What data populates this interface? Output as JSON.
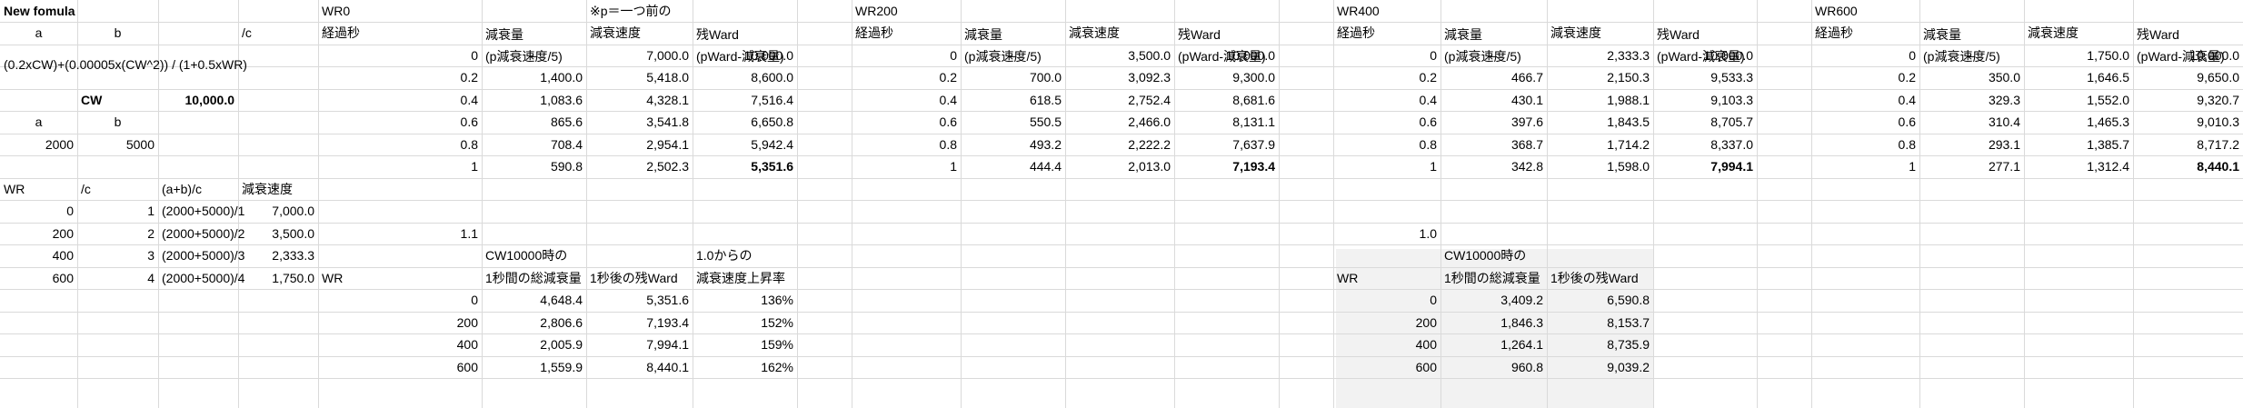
{
  "cells": [
    {
      "r": 0,
      "c": 0,
      "t": "New fomula",
      "b": true
    },
    {
      "r": 0,
      "c": 4,
      "t": "WR0"
    },
    {
      "r": 0,
      "c": 6,
      "t": "※p＝一つ前の"
    },
    {
      "r": 0,
      "c": 9,
      "t": "WR200"
    },
    {
      "r": 0,
      "c": 14,
      "t": "WR400"
    },
    {
      "r": 0,
      "c": 19,
      "t": "WR600"
    },
    {
      "r": 1,
      "c": 0,
      "t": "a",
      "a": "c"
    },
    {
      "r": 1,
      "c": 1,
      "t": "b",
      "a": "c"
    },
    {
      "r": 1,
      "c": 3,
      "t": "/c"
    },
    {
      "r": 1,
      "c": 4,
      "t": "経過秒"
    },
    {
      "r": 1,
      "c": 5,
      "t": "減衰量",
      "half": "top"
    },
    {
      "r": 1,
      "c": 5,
      "t": "(p減衰速度/5)",
      "half": "bot"
    },
    {
      "r": 1,
      "c": 6,
      "t": "減衰速度"
    },
    {
      "r": 1,
      "c": 7,
      "t": "残Ward",
      "half": "top"
    },
    {
      "r": 1,
      "c": 7,
      "t": "(pWard-減衰量)",
      "half": "bot"
    },
    {
      "r": 1,
      "c": 9,
      "t": "経過秒"
    },
    {
      "r": 1,
      "c": 10,
      "t": "減衰量",
      "half": "top"
    },
    {
      "r": 1,
      "c": 10,
      "t": "(p減衰速度/5)",
      "half": "bot"
    },
    {
      "r": 1,
      "c": 11,
      "t": "減衰速度"
    },
    {
      "r": 1,
      "c": 12,
      "t": "残Ward",
      "half": "top"
    },
    {
      "r": 1,
      "c": 12,
      "t": "(pWard-減衰量)",
      "half": "bot"
    },
    {
      "r": 1,
      "c": 14,
      "t": "経過秒"
    },
    {
      "r": 1,
      "c": 15,
      "t": "減衰量",
      "half": "top"
    },
    {
      "r": 1,
      "c": 15,
      "t": "(p減衰速度/5)",
      "half": "bot"
    },
    {
      "r": 1,
      "c": 16,
      "t": "減衰速度"
    },
    {
      "r": 1,
      "c": 17,
      "t": "残Ward",
      "half": "top"
    },
    {
      "r": 1,
      "c": 17,
      "t": "(pWard-減衰量)",
      "half": "bot"
    },
    {
      "r": 1,
      "c": 19,
      "t": "経過秒"
    },
    {
      "r": 1,
      "c": 20,
      "t": "減衰量",
      "half": "top"
    },
    {
      "r": 1,
      "c": 20,
      "t": "(p減衰速度/5)",
      "half": "bot"
    },
    {
      "r": 1,
      "c": 21,
      "t": "減衰速度"
    },
    {
      "r": 1,
      "c": 22,
      "t": "残Ward",
      "half": "top"
    },
    {
      "r": 1,
      "c": 22,
      "t": "(pWard-減衰量)",
      "half": "bot"
    },
    {
      "r": 2,
      "c": 0,
      "t": "(0.2xCW)+(0.00005x(CW^2)) / (1+0.5xWR)",
      "y": "low"
    },
    {
      "r": 2,
      "c": 4,
      "t": "0",
      "a": "r"
    },
    {
      "r": 2,
      "c": 5,
      "t": "–",
      "a": "c"
    },
    {
      "r": 2,
      "c": 6,
      "t": "7,000.0",
      "a": "r"
    },
    {
      "r": 2,
      "c": 7,
      "t": "10,000.0",
      "a": "r"
    },
    {
      "r": 2,
      "c": 9,
      "t": "0",
      "a": "r"
    },
    {
      "r": 2,
      "c": 10,
      "t": "–",
      "a": "c"
    },
    {
      "r": 2,
      "c": 11,
      "t": "3,500.0",
      "a": "r"
    },
    {
      "r": 2,
      "c": 12,
      "t": "10,000.0",
      "a": "r"
    },
    {
      "r": 2,
      "c": 14,
      "t": "0",
      "a": "r"
    },
    {
      "r": 2,
      "c": 15,
      "t": "–",
      "a": "c"
    },
    {
      "r": 2,
      "c": 16,
      "t": "2,333.3",
      "a": "r"
    },
    {
      "r": 2,
      "c": 17,
      "t": "10,000.0",
      "a": "r"
    },
    {
      "r": 2,
      "c": 19,
      "t": "0",
      "a": "r"
    },
    {
      "r": 2,
      "c": 20,
      "t": "–",
      "a": "c"
    },
    {
      "r": 2,
      "c": 21,
      "t": "1,750.0",
      "a": "r"
    },
    {
      "r": 2,
      "c": 22,
      "t": "10,000.0",
      "a": "r"
    },
    {
      "r": 3,
      "c": 4,
      "t": "0.2",
      "a": "r"
    },
    {
      "r": 3,
      "c": 5,
      "t": "1,400.0",
      "a": "r"
    },
    {
      "r": 3,
      "c": 6,
      "t": "5,418.0",
      "a": "r"
    },
    {
      "r": 3,
      "c": 7,
      "t": "8,600.0",
      "a": "r"
    },
    {
      "r": 3,
      "c": 9,
      "t": "0.2",
      "a": "r"
    },
    {
      "r": 3,
      "c": 10,
      "t": "700.0",
      "a": "r"
    },
    {
      "r": 3,
      "c": 11,
      "t": "3,092.3",
      "a": "r"
    },
    {
      "r": 3,
      "c": 12,
      "t": "9,300.0",
      "a": "r"
    },
    {
      "r": 3,
      "c": 14,
      "t": "0.2",
      "a": "r"
    },
    {
      "r": 3,
      "c": 15,
      "t": "466.7",
      "a": "r"
    },
    {
      "r": 3,
      "c": 16,
      "t": "2,150.3",
      "a": "r"
    },
    {
      "r": 3,
      "c": 17,
      "t": "9,533.3",
      "a": "r"
    },
    {
      "r": 3,
      "c": 19,
      "t": "0.2",
      "a": "r"
    },
    {
      "r": 3,
      "c": 20,
      "t": "350.0",
      "a": "r"
    },
    {
      "r": 3,
      "c": 21,
      "t": "1,646.5",
      "a": "r"
    },
    {
      "r": 3,
      "c": 22,
      "t": "9,650.0",
      "a": "r"
    },
    {
      "r": 4,
      "c": 1,
      "t": "CW",
      "b": true
    },
    {
      "r": 4,
      "c": 2,
      "t": "10,000.0",
      "b": true,
      "a": "r"
    },
    {
      "r": 4,
      "c": 4,
      "t": "0.4",
      "a": "r"
    },
    {
      "r": 4,
      "c": 5,
      "t": "1,083.6",
      "a": "r"
    },
    {
      "r": 4,
      "c": 6,
      "t": "4,328.1",
      "a": "r"
    },
    {
      "r": 4,
      "c": 7,
      "t": "7,516.4",
      "a": "r"
    },
    {
      "r": 4,
      "c": 9,
      "t": "0.4",
      "a": "r"
    },
    {
      "r": 4,
      "c": 10,
      "t": "618.5",
      "a": "r"
    },
    {
      "r": 4,
      "c": 11,
      "t": "2,752.4",
      "a": "r"
    },
    {
      "r": 4,
      "c": 12,
      "t": "8,681.6",
      "a": "r"
    },
    {
      "r": 4,
      "c": 14,
      "t": "0.4",
      "a": "r"
    },
    {
      "r": 4,
      "c": 15,
      "t": "430.1",
      "a": "r"
    },
    {
      "r": 4,
      "c": 16,
      "t": "1,988.1",
      "a": "r"
    },
    {
      "r": 4,
      "c": 17,
      "t": "9,103.3",
      "a": "r"
    },
    {
      "r": 4,
      "c": 19,
      "t": "0.4",
      "a": "r"
    },
    {
      "r": 4,
      "c": 20,
      "t": "329.3",
      "a": "r"
    },
    {
      "r": 4,
      "c": 21,
      "t": "1,552.0",
      "a": "r"
    },
    {
      "r": 4,
      "c": 22,
      "t": "9,320.7",
      "a": "r"
    },
    {
      "r": 5,
      "c": 0,
      "t": "a",
      "a": "c"
    },
    {
      "r": 5,
      "c": 1,
      "t": "b",
      "a": "c"
    },
    {
      "r": 5,
      "c": 4,
      "t": "0.6",
      "a": "r"
    },
    {
      "r": 5,
      "c": 5,
      "t": "865.6",
      "a": "r"
    },
    {
      "r": 5,
      "c": 6,
      "t": "3,541.8",
      "a": "r"
    },
    {
      "r": 5,
      "c": 7,
      "t": "6,650.8",
      "a": "r"
    },
    {
      "r": 5,
      "c": 9,
      "t": "0.6",
      "a": "r"
    },
    {
      "r": 5,
      "c": 10,
      "t": "550.5",
      "a": "r"
    },
    {
      "r": 5,
      "c": 11,
      "t": "2,466.0",
      "a": "r"
    },
    {
      "r": 5,
      "c": 12,
      "t": "8,131.1",
      "a": "r"
    },
    {
      "r": 5,
      "c": 14,
      "t": "0.6",
      "a": "r"
    },
    {
      "r": 5,
      "c": 15,
      "t": "397.6",
      "a": "r"
    },
    {
      "r": 5,
      "c": 16,
      "t": "1,843.5",
      "a": "r"
    },
    {
      "r": 5,
      "c": 17,
      "t": "8,705.7",
      "a": "r"
    },
    {
      "r": 5,
      "c": 19,
      "t": "0.6",
      "a": "r"
    },
    {
      "r": 5,
      "c": 20,
      "t": "310.4",
      "a": "r"
    },
    {
      "r": 5,
      "c": 21,
      "t": "1,465.3",
      "a": "r"
    },
    {
      "r": 5,
      "c": 22,
      "t": "9,010.3",
      "a": "r"
    },
    {
      "r": 6,
      "c": 0,
      "t": "2000",
      "a": "r"
    },
    {
      "r": 6,
      "c": 1,
      "t": "5000",
      "a": "r"
    },
    {
      "r": 6,
      "c": 4,
      "t": "0.8",
      "a": "r"
    },
    {
      "r": 6,
      "c": 5,
      "t": "708.4",
      "a": "r"
    },
    {
      "r": 6,
      "c": 6,
      "t": "2,954.1",
      "a": "r"
    },
    {
      "r": 6,
      "c": 7,
      "t": "5,942.4",
      "a": "r"
    },
    {
      "r": 6,
      "c": 9,
      "t": "0.8",
      "a": "r"
    },
    {
      "r": 6,
      "c": 10,
      "t": "493.2",
      "a": "r"
    },
    {
      "r": 6,
      "c": 11,
      "t": "2,222.2",
      "a": "r"
    },
    {
      "r": 6,
      "c": 12,
      "t": "7,637.9",
      "a": "r"
    },
    {
      "r": 6,
      "c": 14,
      "t": "0.8",
      "a": "r"
    },
    {
      "r": 6,
      "c": 15,
      "t": "368.7",
      "a": "r"
    },
    {
      "r": 6,
      "c": 16,
      "t": "1,714.2",
      "a": "r"
    },
    {
      "r": 6,
      "c": 17,
      "t": "8,337.0",
      "a": "r"
    },
    {
      "r": 6,
      "c": 19,
      "t": "0.8",
      "a": "r"
    },
    {
      "r": 6,
      "c": 20,
      "t": "293.1",
      "a": "r"
    },
    {
      "r": 6,
      "c": 21,
      "t": "1,385.7",
      "a": "r"
    },
    {
      "r": 6,
      "c": 22,
      "t": "8,717.2",
      "a": "r"
    },
    {
      "r": 7,
      "c": 4,
      "t": "1",
      "a": "r"
    },
    {
      "r": 7,
      "c": 5,
      "t": "590.8",
      "a": "r"
    },
    {
      "r": 7,
      "c": 6,
      "t": "2,502.3",
      "a": "r"
    },
    {
      "r": 7,
      "c": 7,
      "t": "5,351.6",
      "a": "r",
      "b": true
    },
    {
      "r": 7,
      "c": 9,
      "t": "1",
      "a": "r"
    },
    {
      "r": 7,
      "c": 10,
      "t": "444.4",
      "a": "r"
    },
    {
      "r": 7,
      "c": 11,
      "t": "2,013.0",
      "a": "r"
    },
    {
      "r": 7,
      "c": 12,
      "t": "7,193.4",
      "a": "r",
      "b": true
    },
    {
      "r": 7,
      "c": 14,
      "t": "1",
      "a": "r"
    },
    {
      "r": 7,
      "c": 15,
      "t": "342.8",
      "a": "r"
    },
    {
      "r": 7,
      "c": 16,
      "t": "1,598.0",
      "a": "r"
    },
    {
      "r": 7,
      "c": 17,
      "t": "7,994.1",
      "a": "r",
      "b": true
    },
    {
      "r": 7,
      "c": 19,
      "t": "1",
      "a": "r"
    },
    {
      "r": 7,
      "c": 20,
      "t": "277.1",
      "a": "r"
    },
    {
      "r": 7,
      "c": 21,
      "t": "1,312.4",
      "a": "r"
    },
    {
      "r": 7,
      "c": 22,
      "t": "8,440.1",
      "a": "r",
      "b": true
    },
    {
      "r": 8,
      "c": 0,
      "t": "WR"
    },
    {
      "r": 8,
      "c": 1,
      "t": "/c"
    },
    {
      "r": 8,
      "c": 2,
      "t": "(a+b)/c"
    },
    {
      "r": 8,
      "c": 3,
      "t": "減衰速度"
    },
    {
      "r": 9,
      "c": 0,
      "t": "0",
      "a": "r"
    },
    {
      "r": 9,
      "c": 1,
      "t": "1",
      "a": "r"
    },
    {
      "r": 9,
      "c": 2,
      "t": "(2000+5000)/1"
    },
    {
      "r": 9,
      "c": 3,
      "t": "7,000.0",
      "a": "r"
    },
    {
      "r": 10,
      "c": 0,
      "t": "200",
      "a": "r"
    },
    {
      "r": 10,
      "c": 1,
      "t": "2",
      "a": "r"
    },
    {
      "r": 10,
      "c": 2,
      "t": "(2000+5000)/2"
    },
    {
      "r": 10,
      "c": 3,
      "t": "3,500.0",
      "a": "r"
    },
    {
      "r": 10,
      "c": 4,
      "t": "1.1",
      "a": "r"
    },
    {
      "r": 10,
      "c": 14,
      "t": "1.0",
      "a": "r"
    },
    {
      "r": 11,
      "c": 0,
      "t": "400",
      "a": "r"
    },
    {
      "r": 11,
      "c": 1,
      "t": "3",
      "a": "r"
    },
    {
      "r": 11,
      "c": 2,
      "t": "(2000+5000)/3"
    },
    {
      "r": 11,
      "c": 3,
      "t": "2,333.3",
      "a": "r"
    },
    {
      "r": 11,
      "c": 5,
      "t": "CW10000時の"
    },
    {
      "r": 11,
      "c": 7,
      "t": "1.0からの"
    },
    {
      "r": 11,
      "c": 15,
      "t": "CW10000時の"
    },
    {
      "r": 12,
      "c": 0,
      "t": "600",
      "a": "r"
    },
    {
      "r": 12,
      "c": 1,
      "t": "4",
      "a": "r"
    },
    {
      "r": 12,
      "c": 2,
      "t": "(2000+5000)/4"
    },
    {
      "r": 12,
      "c": 3,
      "t": "1,750.0",
      "a": "r"
    },
    {
      "r": 12,
      "c": 4,
      "t": "WR"
    },
    {
      "r": 12,
      "c": 5,
      "t": "1秒間の総減衰量"
    },
    {
      "r": 12,
      "c": 6,
      "t": "1秒後の残Ward"
    },
    {
      "r": 12,
      "c": 7,
      "t": "減衰速度上昇率"
    },
    {
      "r": 12,
      "c": 14,
      "t": "WR"
    },
    {
      "r": 12,
      "c": 15,
      "t": "1秒間の総減衰量"
    },
    {
      "r": 12,
      "c": 16,
      "t": "1秒後の残Ward"
    },
    {
      "r": 13,
      "c": 4,
      "t": "0",
      "a": "r"
    },
    {
      "r": 13,
      "c": 5,
      "t": "4,648.4",
      "a": "r"
    },
    {
      "r": 13,
      "c": 6,
      "t": "5,351.6",
      "a": "r"
    },
    {
      "r": 13,
      "c": 7,
      "t": "136%",
      "a": "r"
    },
    {
      "r": 13,
      "c": 14,
      "t": "0",
      "a": "r"
    },
    {
      "r": 13,
      "c": 15,
      "t": "3,409.2",
      "a": "r"
    },
    {
      "r": 13,
      "c": 16,
      "t": "6,590.8",
      "a": "r"
    },
    {
      "r": 14,
      "c": 4,
      "t": "200",
      "a": "r"
    },
    {
      "r": 14,
      "c": 5,
      "t": "2,806.6",
      "a": "r"
    },
    {
      "r": 14,
      "c": 6,
      "t": "7,193.4",
      "a": "r"
    },
    {
      "r": 14,
      "c": 7,
      "t": "152%",
      "a": "r"
    },
    {
      "r": 14,
      "c": 14,
      "t": "200",
      "a": "r"
    },
    {
      "r": 14,
      "c": 15,
      "t": "1,846.3",
      "a": "r"
    },
    {
      "r": 14,
      "c": 16,
      "t": "8,153.7",
      "a": "r"
    },
    {
      "r": 15,
      "c": 4,
      "t": "400",
      "a": "r"
    },
    {
      "r": 15,
      "c": 5,
      "t": "2,005.9",
      "a": "r"
    },
    {
      "r": 15,
      "c": 6,
      "t": "7,994.1",
      "a": "r"
    },
    {
      "r": 15,
      "c": 7,
      "t": "159%",
      "a": "r"
    },
    {
      "r": 15,
      "c": 14,
      "t": "400",
      "a": "r"
    },
    {
      "r": 15,
      "c": 15,
      "t": "1,264.1",
      "a": "r"
    },
    {
      "r": 15,
      "c": 16,
      "t": "8,735.9",
      "a": "r"
    },
    {
      "r": 16,
      "c": 4,
      "t": "600",
      "a": "r"
    },
    {
      "r": 16,
      "c": 5,
      "t": "1,559.9",
      "a": "r"
    },
    {
      "r": 16,
      "c": 6,
      "t": "8,440.1",
      "a": "r"
    },
    {
      "r": 16,
      "c": 7,
      "t": "162%",
      "a": "r"
    },
    {
      "r": 16,
      "c": 14,
      "t": "600",
      "a": "r"
    },
    {
      "r": 16,
      "c": 15,
      "t": "960.8",
      "a": "r"
    },
    {
      "r": 16,
      "c": 16,
      "t": "9,039.2",
      "a": "r"
    }
  ]
}
